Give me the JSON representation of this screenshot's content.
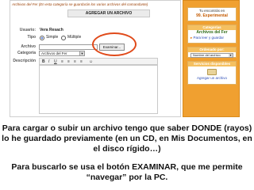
{
  "form": {
    "breadcrumb": "Archivos del Fer (En esta categoría se guardarán los varios archivos del comandante)",
    "header": "AGREGAR UN ARCHIVO",
    "usuario_label": "Usuario:",
    "usuario_value": "Vera Resach",
    "tipo_label": "Tipo",
    "tipo_simple": "Simple",
    "tipo_multiple": "Múltiple",
    "archivo_label": "Archivo",
    "browse_button": "Examinar...",
    "categoria_label": "Categoría",
    "categoria_value": "Archivos del Fer",
    "descripcion_label": "Descripción",
    "toolbar_icons": [
      "B",
      "I",
      "U",
      "≡",
      "≡",
      "≡",
      "≡",
      "☺"
    ]
  },
  "sidebar": {
    "location_title": "Tu encontrás en",
    "location_name": "99. Experimental",
    "categories_header": "Categorías",
    "archive_title": "Archivos del Fer",
    "archive_link": "Para leer y guardar",
    "order_header": "Ordenado por:",
    "order_value": "Nombre del archivo",
    "services_header": "Servicios disponibles",
    "add_link": "Agregar un archivo"
  },
  "captions": {
    "line1": "Para cargar o subir un archivo tengo que saber DONDE (rayos) lo he guardado previamente (en un CD, en Mis Documentos, en el disco rígido…)",
    "line2": "Para buscarlo se usa el botón EXAMINAR, que me permite “navegar” por la PC."
  },
  "colors": {
    "sidebar": "#f0a030",
    "highlight": "#e04a1a",
    "link": "#2a4bb5"
  }
}
